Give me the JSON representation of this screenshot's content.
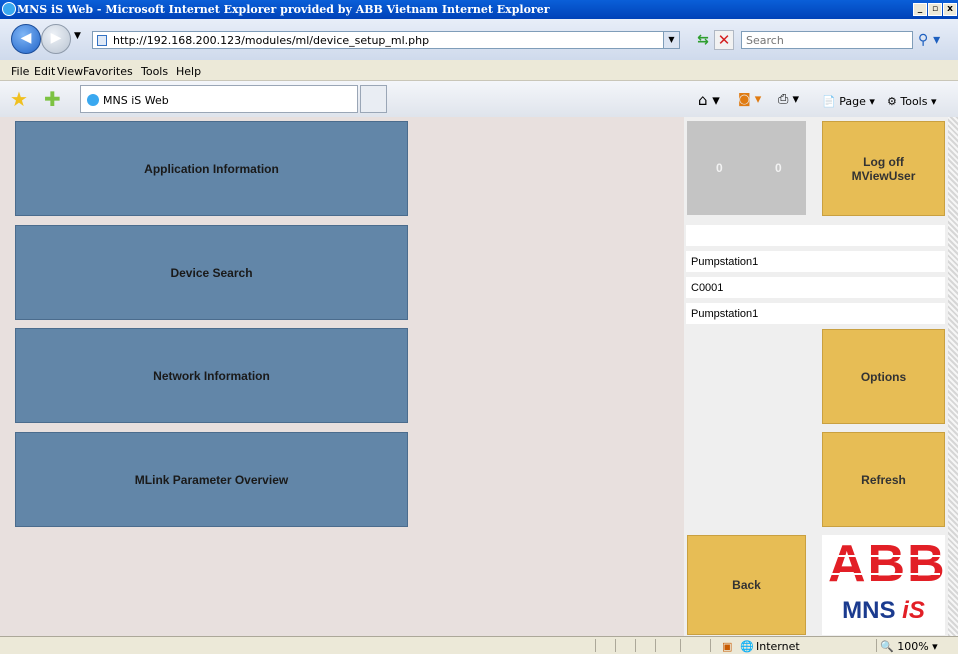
{
  "window": {
    "title": "MNS iS Web - Microsoft Internet Explorer provided by ABB Vietnam Internet Explorer"
  },
  "address": {
    "url": "http://192.168.200.123/modules/ml/device_setup_ml.php",
    "search_placeholder": "Search"
  },
  "menu": [
    "File",
    "Edit",
    "View",
    "Favorites",
    "Tools",
    "Help"
  ],
  "tab": {
    "label": "MNS iS Web"
  },
  "commandbar": {
    "page": "Page",
    "tools": "Tools"
  },
  "main_buttons": [
    "Application Information",
    "Device Search",
    "Network Information",
    "MLink Parameter Overview"
  ],
  "status_box": {
    "left_value": "0",
    "right_value": "0"
  },
  "logoff": {
    "line1": "Log off",
    "line2": "MViewUser"
  },
  "fields": [
    "",
    "Pumpstation1",
    "C0001",
    "Pumpstation1"
  ],
  "side_buttons": {
    "options": "Options",
    "refresh": "Refresh",
    "back": "Back"
  },
  "logo": {
    "brand": "ABB",
    "product": "MNS iS"
  },
  "statusbar": {
    "zone": "Internet",
    "zoom": "100%"
  }
}
